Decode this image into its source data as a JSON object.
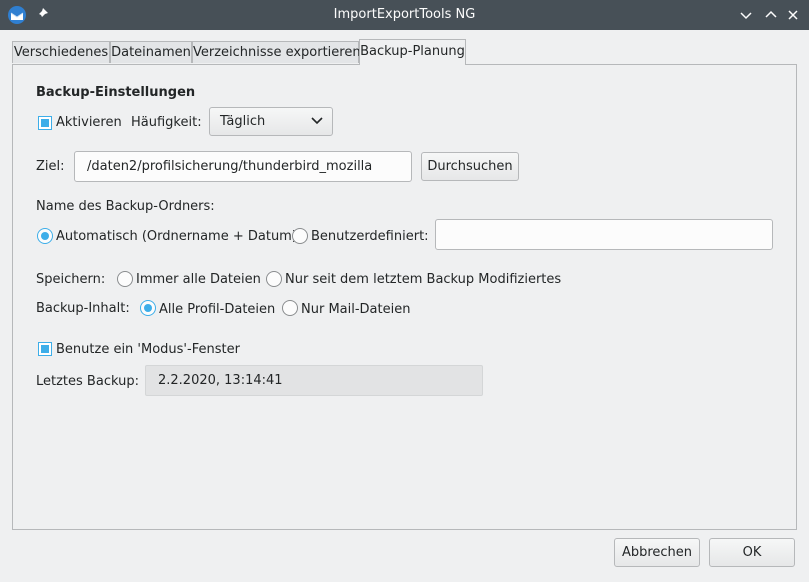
{
  "window": {
    "title": "ImportExportTools NG"
  },
  "tabs": [
    {
      "label": "Verschiedenes"
    },
    {
      "label": "Dateinamen"
    },
    {
      "label": "Verzeichnisse exportieren"
    },
    {
      "label": "Backup-Planung"
    }
  ],
  "backup": {
    "heading": "Backup-Einstellungen",
    "activate_label": "Aktivieren",
    "frequency_label": "Häufigkeit:",
    "frequency_value": "Täglich",
    "target_label": "Ziel:",
    "target_value": "/daten2/profilsicherung/thunderbird_mozilla",
    "browse_label": "Durchsuchen",
    "folder_name_label": "Name des Backup-Ordners:",
    "folder_auto_label": "Automatisch (Ordnername + Datum)",
    "folder_custom_label": "Benutzerdefiniert:",
    "folder_custom_value": "",
    "save_label": "Speichern:",
    "save_all_label": "Immer alle Dateien",
    "save_modified_label": "Nur seit dem letztem Backup Modifiziertes",
    "content_label": "Backup-Inhalt:",
    "content_all_label": "Alle Profil-Dateien",
    "content_mail_label": "Nur Mail-Dateien",
    "modal_label": "Benutze ein 'Modus'-Fenster",
    "last_backup_label": "Letztes Backup:",
    "last_backup_value": "2.2.2020, 13:14:41"
  },
  "buttons": {
    "cancel": "Abbrechen",
    "ok": "OK"
  },
  "colors": {
    "accent": "#3daee9",
    "titlebar": "#475057",
    "background": "#eff0f1"
  }
}
